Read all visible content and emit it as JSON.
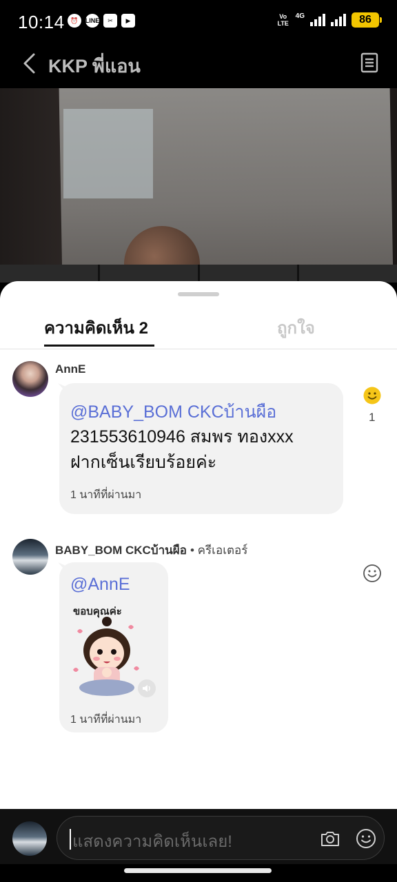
{
  "status_bar": {
    "time": "10:14",
    "network": "4G",
    "volte": "Vo LTE",
    "battery": "86"
  },
  "header": {
    "title": "KKP พี่แอน"
  },
  "tabs": {
    "comments": "ความคิดเห็น 2",
    "likes": "ถูกใจ"
  },
  "comments": [
    {
      "username": "AnnE",
      "mention": "@BABY_BOM CKCบ้านผือ",
      "text_lines": [
        "231553610946 สมพร ทองxxx",
        "ฝากเซ็นเรียบร้อยค่ะ"
      ],
      "time": "1 นาทีที่ผ่านมา",
      "reaction_count": "1"
    },
    {
      "username": "BABY_BOM CKCบ้านผือ",
      "badge": "• ครีเอเตอร์",
      "mention": "@AnnE",
      "sticker_text": "ขอบคุณค่ะ",
      "time": "1 นาทีที่ผ่านมา"
    }
  ],
  "input": {
    "placeholder": "แสดงความคิดเห็นเลย!"
  },
  "colors": {
    "mention": "#5a6fd6",
    "battery": "#f2c500",
    "reaction_active": "#f5c518"
  }
}
